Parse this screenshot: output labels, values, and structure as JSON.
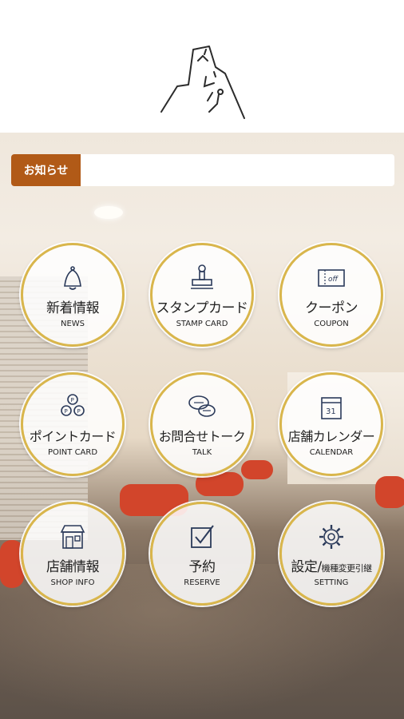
{
  "header": {
    "logo_text": "ベルパ"
  },
  "notice": {
    "label": "お知らせ",
    "body": ""
  },
  "menu": {
    "news": {
      "title": "新着情報",
      "sub": "NEWS",
      "icon": "bell-icon"
    },
    "stamp": {
      "title": "スタンプカード",
      "sub": "STAMP CARD",
      "icon": "stamp-icon"
    },
    "coupon": {
      "title": "クーポン",
      "sub": "COUPON",
      "icon": "coupon-icon"
    },
    "point": {
      "title": "ポイントカード",
      "sub": "POINT CARD",
      "icon": "coins-icon"
    },
    "talk": {
      "title": "お問合せトーク",
      "sub": "TALK",
      "icon": "chat-icon"
    },
    "calendar": {
      "title": "店舗カレンダー",
      "sub": "CALENDAR",
      "icon": "calendar-icon",
      "day": "31"
    },
    "shop": {
      "title": "店舗情報",
      "sub": "SHOP INFO",
      "icon": "shop-icon"
    },
    "reserve": {
      "title": "予約",
      "sub": "RESERVE",
      "icon": "checkbox-icon"
    },
    "setting": {
      "title": "設定/",
      "title_suffix": "機種変更引継",
      "sub": "SETTING",
      "icon": "gear-icon"
    }
  },
  "colors": {
    "notice_label_bg": "#b15a17",
    "button_ring": "#d9b64c",
    "chair_red": "#d2452b"
  }
}
